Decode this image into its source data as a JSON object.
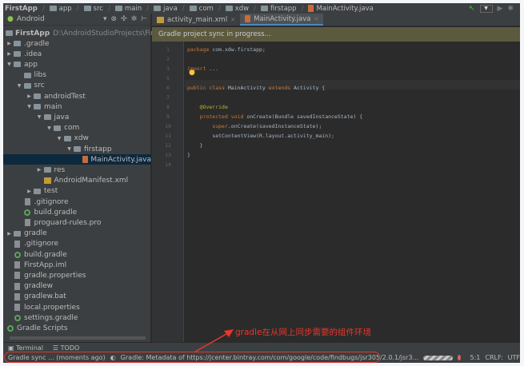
{
  "breadcrumbs": [
    "FirstApp",
    "app",
    "src",
    "main",
    "java",
    "com",
    "xdw",
    "firstapp",
    "MainActivity.java"
  ],
  "sidebar": {
    "view": "Android",
    "project": "FirstApp",
    "project_path": "D:\\AndroidStudioProjects\\FirstApp",
    "items": [
      {
        "label": ".gradle",
        "level": 0,
        "arrow": "right",
        "icon": "folder"
      },
      {
        "label": ".idea",
        "level": 0,
        "arrow": "right",
        "icon": "folder"
      },
      {
        "label": "app",
        "level": 0,
        "arrow": "down",
        "icon": "folder"
      },
      {
        "label": "libs",
        "level": 1,
        "arrow": "",
        "icon": "folder"
      },
      {
        "label": "src",
        "level": 1,
        "arrow": "down",
        "icon": "folder"
      },
      {
        "label": "androidTest",
        "level": 2,
        "arrow": "right",
        "icon": "folder"
      },
      {
        "label": "main",
        "level": 2,
        "arrow": "down",
        "icon": "folder"
      },
      {
        "label": "java",
        "level": 3,
        "arrow": "down",
        "icon": "folder"
      },
      {
        "label": "com",
        "level": 4,
        "arrow": "down",
        "icon": "folder"
      },
      {
        "label": "xdw",
        "level": 5,
        "arrow": "down",
        "icon": "folder"
      },
      {
        "label": "firstapp",
        "level": 6,
        "arrow": "down",
        "icon": "folder"
      },
      {
        "label": "MainActivity.java",
        "level": 7,
        "arrow": "",
        "icon": "java",
        "selected": true
      },
      {
        "label": "res",
        "level": 3,
        "arrow": "right",
        "icon": "folder"
      },
      {
        "label": "AndroidManifest.xml",
        "level": 3,
        "arrow": "",
        "icon": "xml"
      },
      {
        "label": "test",
        "level": 2,
        "arrow": "right",
        "icon": "folder"
      },
      {
        "label": ".gitignore",
        "level": 1,
        "arrow": "",
        "icon": "file"
      },
      {
        "label": "build.gradle",
        "level": 1,
        "arrow": "",
        "icon": "gradle"
      },
      {
        "label": "proguard-rules.pro",
        "level": 1,
        "arrow": "",
        "icon": "file"
      },
      {
        "label": "gradle",
        "level": 0,
        "arrow": "right",
        "icon": "folder"
      },
      {
        "label": ".gitignore",
        "level": 0,
        "arrow": "",
        "icon": "file"
      },
      {
        "label": "build.gradle",
        "level": 0,
        "arrow": "",
        "icon": "gradle"
      },
      {
        "label": "FirstApp.iml",
        "level": 0,
        "arrow": "",
        "icon": "file"
      },
      {
        "label": "gradle.properties",
        "level": 0,
        "arrow": "",
        "icon": "file"
      },
      {
        "label": "gradlew",
        "level": 0,
        "arrow": "",
        "icon": "file"
      },
      {
        "label": "gradlew.bat",
        "level": 0,
        "arrow": "",
        "icon": "file"
      },
      {
        "label": "local.properties",
        "level": 0,
        "arrow": "",
        "icon": "file"
      },
      {
        "label": "settings.gradle",
        "level": 0,
        "arrow": "",
        "icon": "gradle"
      },
      {
        "label": "Gradle Scripts",
        "level": -1,
        "arrow": "",
        "icon": "gradle"
      }
    ]
  },
  "tabs": [
    {
      "label": "activity_main.xml",
      "active": false
    },
    {
      "label": "MainActivity.java",
      "active": true
    }
  ],
  "banner": "Gradle project sync in progress...",
  "code": [
    {
      "n": "1",
      "t": [
        [
          "kw",
          "package "
        ],
        [
          "pl",
          "com.xdw.firstapp;"
        ]
      ]
    },
    {
      "n": "2",
      "t": []
    },
    {
      "n": "3",
      "t": [
        [
          "kw",
          "import "
        ],
        [
          "pl",
          "..."
        ]
      ]
    },
    {
      "n": "5",
      "t": []
    },
    {
      "n": "6",
      "t": [
        [
          "kw",
          "public class "
        ],
        [
          "pl",
          "MainActivity "
        ],
        [
          "kw",
          "extends "
        ],
        [
          "pl",
          "Activity {"
        ]
      ]
    },
    {
      "n": "7",
      "t": []
    },
    {
      "n": "8",
      "t": [
        [
          "an",
          "    @Override"
        ]
      ]
    },
    {
      "n": "9",
      "t": [
        [
          "kw",
          "    protected void "
        ],
        [
          "pl",
          "onCreate(Bundle savedInstanceState) {"
        ]
      ]
    },
    {
      "n": "10",
      "t": [
        [
          "kw",
          "        super"
        ],
        [
          "pl",
          ".onCreate(savedInstanceState);"
        ]
      ]
    },
    {
      "n": "11",
      "t": [
        [
          "pl",
          "        setContentView(R.layout.activity_main);"
        ]
      ]
    },
    {
      "n": "12",
      "t": [
        [
          "pl",
          "    }"
        ]
      ]
    },
    {
      "n": "13",
      "t": [
        [
          "pl",
          "}"
        ]
      ]
    },
    {
      "n": "14",
      "t": []
    }
  ],
  "annotation": "gradle在从网上同步需要的组件环境",
  "toolwindows": [
    "Terminal",
    "TODO"
  ],
  "status": {
    "left": "Gradle sync ... (moments ago)",
    "message": "Gradle: Metadata of https://jcenter.bintray.com/com/google/code/findbugs/jsr305/2.0.1/jsr3...",
    "position": "5:1",
    "line_sep": "CRLF:",
    "encoding": "UTF"
  },
  "colors": {
    "annotation": "#e8362c",
    "keyword": "#cc7832",
    "banner": "#5b5a3f"
  }
}
